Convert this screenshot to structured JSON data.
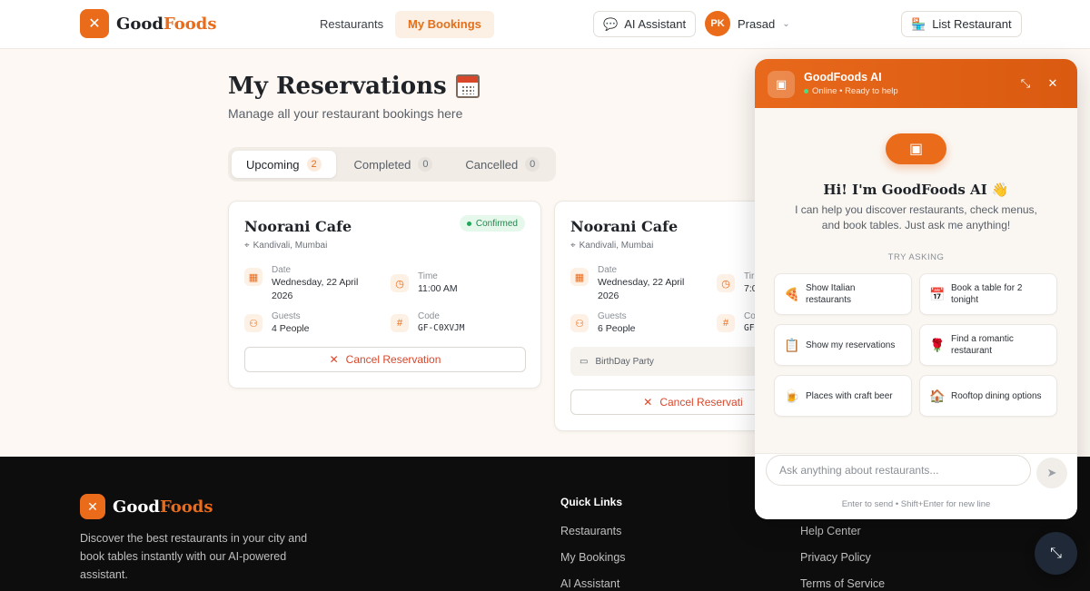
{
  "header": {
    "brand_part1": "Good",
    "brand_part2": "Foods",
    "nav": [
      "Restaurants",
      "My Bookings"
    ],
    "ai_button": "AI Assistant",
    "user_initials": "PK",
    "user_name": "Prasad",
    "list_button": "List Restaurant"
  },
  "page": {
    "title": "My Reservations",
    "subtitle": "Manage all your restaurant bookings here"
  },
  "tabs": [
    {
      "label": "Upcoming",
      "count": "2"
    },
    {
      "label": "Completed",
      "count": "0"
    },
    {
      "label": "Cancelled",
      "count": "0"
    }
  ],
  "cards": [
    {
      "name": "Noorani Cafe",
      "location": "Kandivali, Mumbai",
      "status": "Confirmed",
      "date_label": "Date",
      "date_line1": "Wednesday, 22 April",
      "date_line2": "2026",
      "time_label": "Time",
      "time": "11:00 AM",
      "guests_label": "Guests",
      "guests": "4 People",
      "code_label": "Code",
      "code": "GF-C0XVJM",
      "cancel": "Cancel Reservation"
    },
    {
      "name": "Noorani Cafe",
      "location": "Kandivali, Mumbai",
      "date_label": "Date",
      "date_line1": "Wednesday, 22 April",
      "date_line2": "2026",
      "time_label": "Tir",
      "time": "7:0",
      "guests_label": "Guests",
      "guests": "6 People",
      "code_label": "Co",
      "code": "GF",
      "note": "BirthDay Party",
      "cancel": "Cancel Reservati"
    }
  ],
  "footer": {
    "brand_part1": "Good",
    "brand_part2": "Foods",
    "description": "Discover the best restaurants in your city and book tables instantly with our AI-powered assistant.",
    "quick_links_title": "Quick Links",
    "quick_links": [
      "Restaurants",
      "My Bookings",
      "AI Assistant"
    ],
    "support_links": [
      "Help Center",
      "Privacy Policy",
      "Terms of Service"
    ]
  },
  "chat": {
    "title": "GoodFoods AI",
    "status": "Online • Ready to help",
    "greeting": "Hi! I'm GoodFoods AI 👋",
    "intro": "I can help you discover restaurants, check menus, and book tables. Just ask me anything!",
    "try_label": "TRY ASKING",
    "suggestions": [
      {
        "icon": "🍕",
        "text": "Show Italian restaurants"
      },
      {
        "icon": "📅",
        "text": "Book a table for 2 tonight"
      },
      {
        "icon": "📋",
        "text": "Show my reservations"
      },
      {
        "icon": "🌹",
        "text": "Find a romantic restaurant"
      },
      {
        "icon": "🍺",
        "text": "Places with craft beer"
      },
      {
        "icon": "🏠",
        "text": "Rooftop dining options"
      }
    ],
    "input_placeholder": "Ask anything about restaurants...",
    "hint": "Enter to send • Shift+Enter for new line"
  },
  "colors": {
    "brand": "#ea6b1a",
    "success": "#1e8a4a",
    "danger": "#d9472b",
    "footer_bg": "#0d0d0d"
  }
}
